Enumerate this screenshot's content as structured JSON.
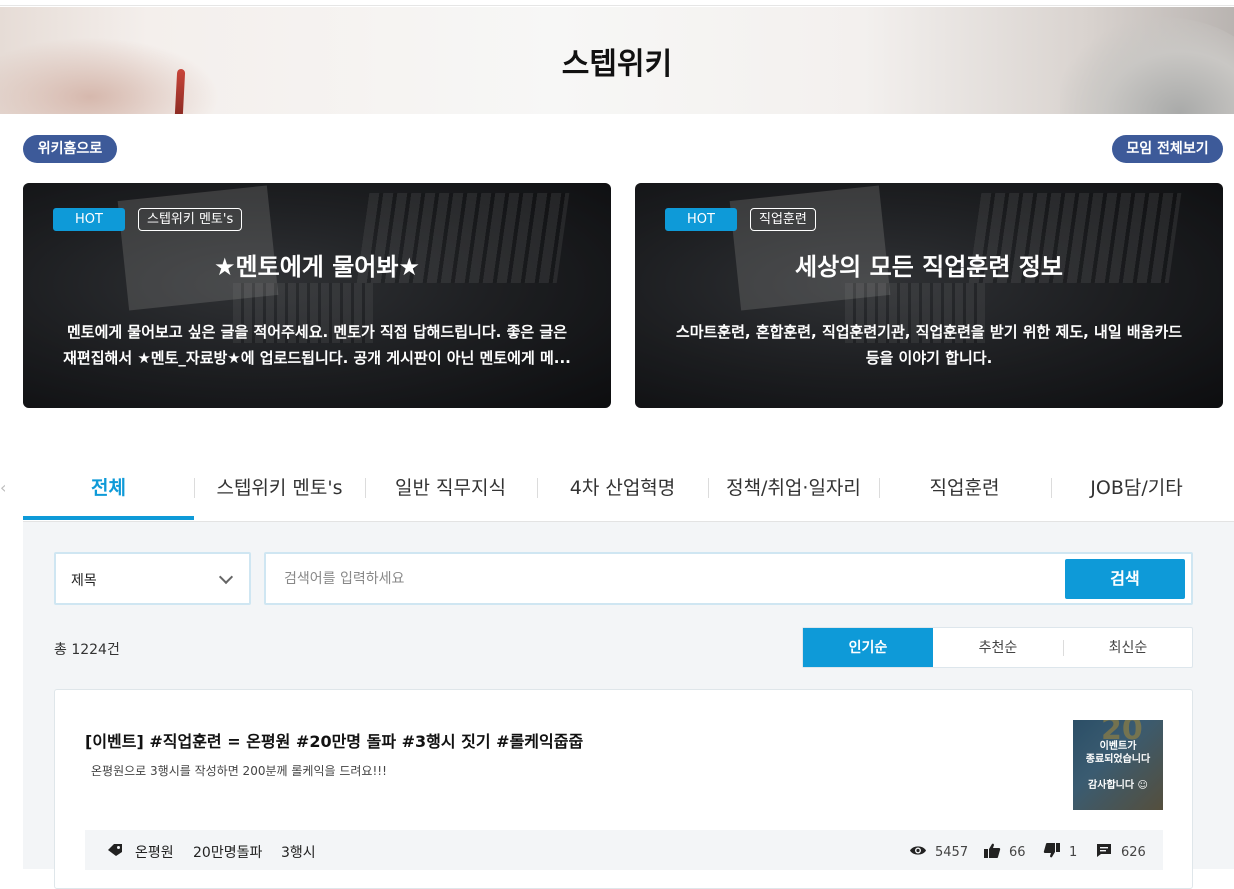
{
  "header": {
    "title": "스텝위키"
  },
  "nav_buttons": {
    "wiki_home": "위키홈으로",
    "all_groups": "모임 전체보기"
  },
  "featured": [
    {
      "hot": "HOT",
      "category": "스텝위키 멘토's",
      "title": "★멘토에게 물어봐★",
      "desc_line1": "멘토에게 물어보고 싶은 글을 적어주세요. 멘토가 직접 답해드립니다. 좋은 글은",
      "desc_line2": "재편집해서 ★멘토_자료방★에 업로드됩니다. 공개 게시판이 아닌 멘토에게 메..."
    },
    {
      "hot": "HOT",
      "category": "직업훈련",
      "title": "세상의 모든 직업훈련 정보",
      "desc_line1": "스마트훈련, 혼합훈련, 직업훈련기관, 직업훈련을 받기 위한 제도, 내일 배움카드",
      "desc_line2": "등을 이야기 합니다."
    }
  ],
  "tabs": [
    "전체",
    "스텝위키 멘토's",
    "일반 직무지식",
    "4차 산업혁명",
    "정책/취업·일자리",
    "직업훈련",
    "JOB담/기타"
  ],
  "search": {
    "field_value": "제목",
    "placeholder": "검색어를 입력하세요",
    "button": "검색"
  },
  "result_count": "총 1224건",
  "sort_options": [
    "인기순",
    "추천순",
    "최신순"
  ],
  "posts": [
    {
      "title": "[이벤트] #직업훈련 = 온평원 #20만명 돌파 #3행시 짓기 #롤케익줍줍",
      "desc": "온평원으로 3행시를 작성하면 200분께 롤케익을 드려요!!!",
      "thumb_number": "20",
      "thumb_text1": "이벤트가",
      "thumb_text2": "종료되었습니다",
      "thumb_text3": "감사합니다 ☺",
      "keywords": [
        "온평원",
        "20만명돌파",
        "3행시"
      ],
      "views": "5457",
      "likes": "66",
      "dislikes": "1",
      "comments": "626"
    }
  ],
  "colors": {
    "accent": "#0e9ad8",
    "navy_pill": "#3d5a99",
    "panel_bg": "#f3f5f7"
  }
}
